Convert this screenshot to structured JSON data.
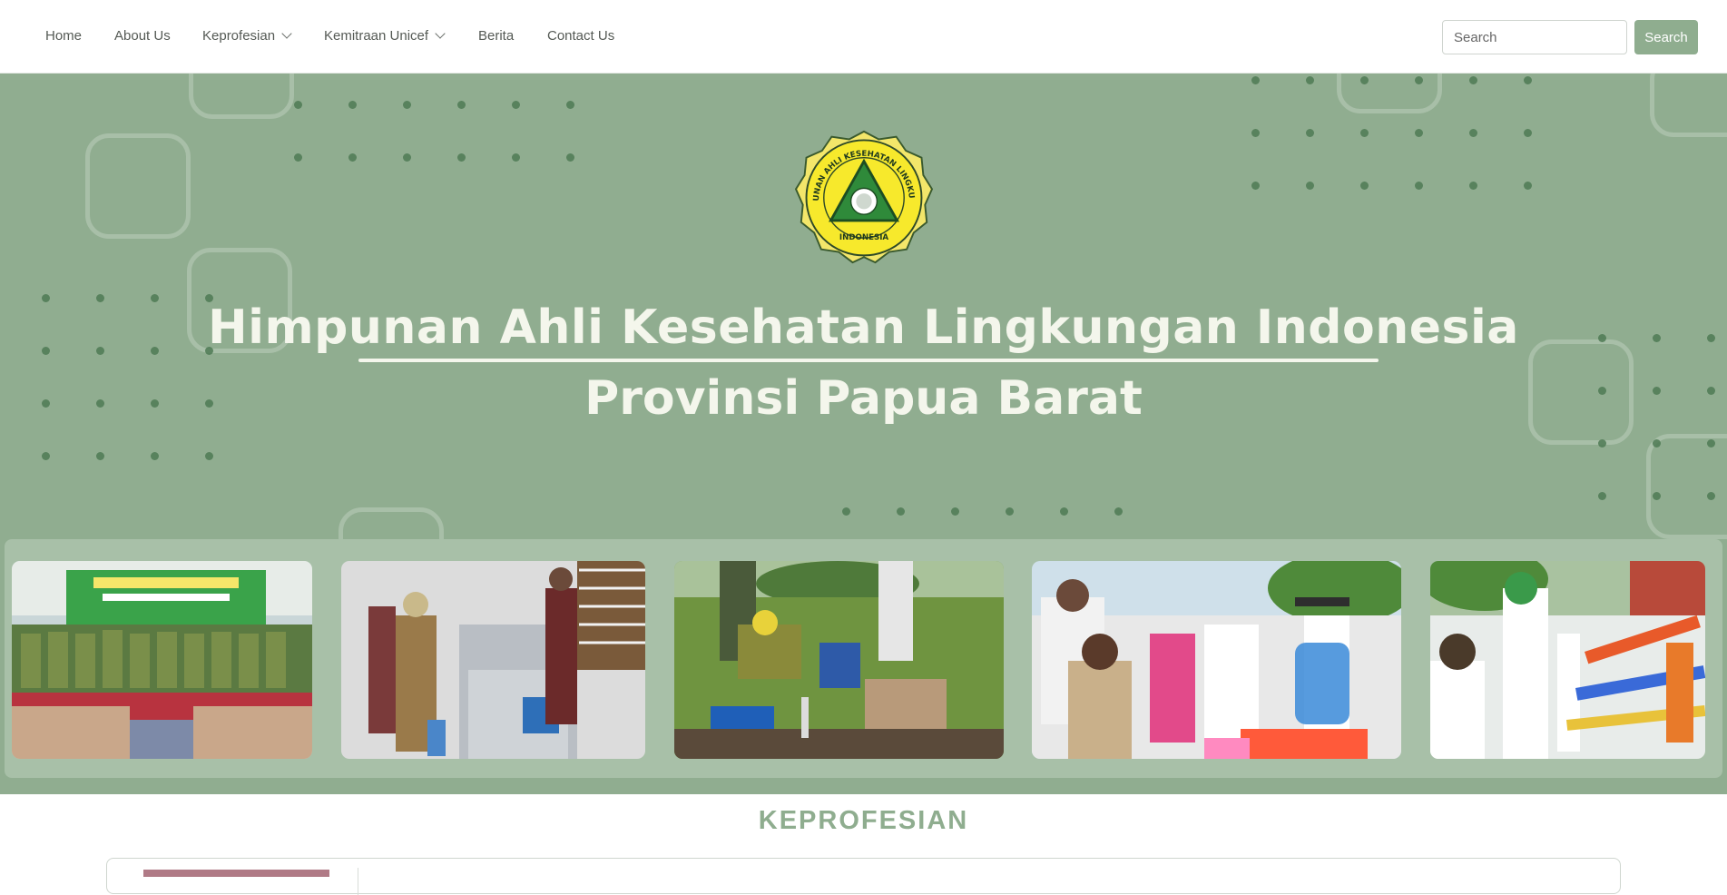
{
  "nav": {
    "items": [
      {
        "label": "Home",
        "dropdown": false
      },
      {
        "label": "About Us",
        "dropdown": false
      },
      {
        "label": "Keprofesian",
        "dropdown": true
      },
      {
        "label": "Kemitraan Unicef",
        "dropdown": true
      },
      {
        "label": "Berita",
        "dropdown": false
      },
      {
        "label": "Contact Us",
        "dropdown": false
      }
    ],
    "search_placeholder": "Search",
    "search_button": "Search"
  },
  "hero": {
    "title_line1": "Himpunan Ahli Kesehatan Lingkungan Indonesia",
    "title_line2": "Provinsi Papua Barat",
    "logo": {
      "ring_text_top": "HIMPUNAN AHLI KESEHATAN LINGKUNGAN",
      "ring_text_bottom": "INDONESIA",
      "icon": "hakli-emblem-icon"
    },
    "gallery": [
      {
        "icon": "photo-meeting-group"
      },
      {
        "icon": "photo-equipment-inspection"
      },
      {
        "icon": "photo-field-digging"
      },
      {
        "icon": "photo-children-water-tank"
      },
      {
        "icon": "photo-handwashing-station"
      }
    ]
  },
  "section": {
    "title": "KEPROFESIAN"
  },
  "colors": {
    "brand_green": "#90ad90",
    "accent_button": "#8fad8f",
    "hero_text": "#f4f6ec",
    "dot": "#4f7a55"
  }
}
